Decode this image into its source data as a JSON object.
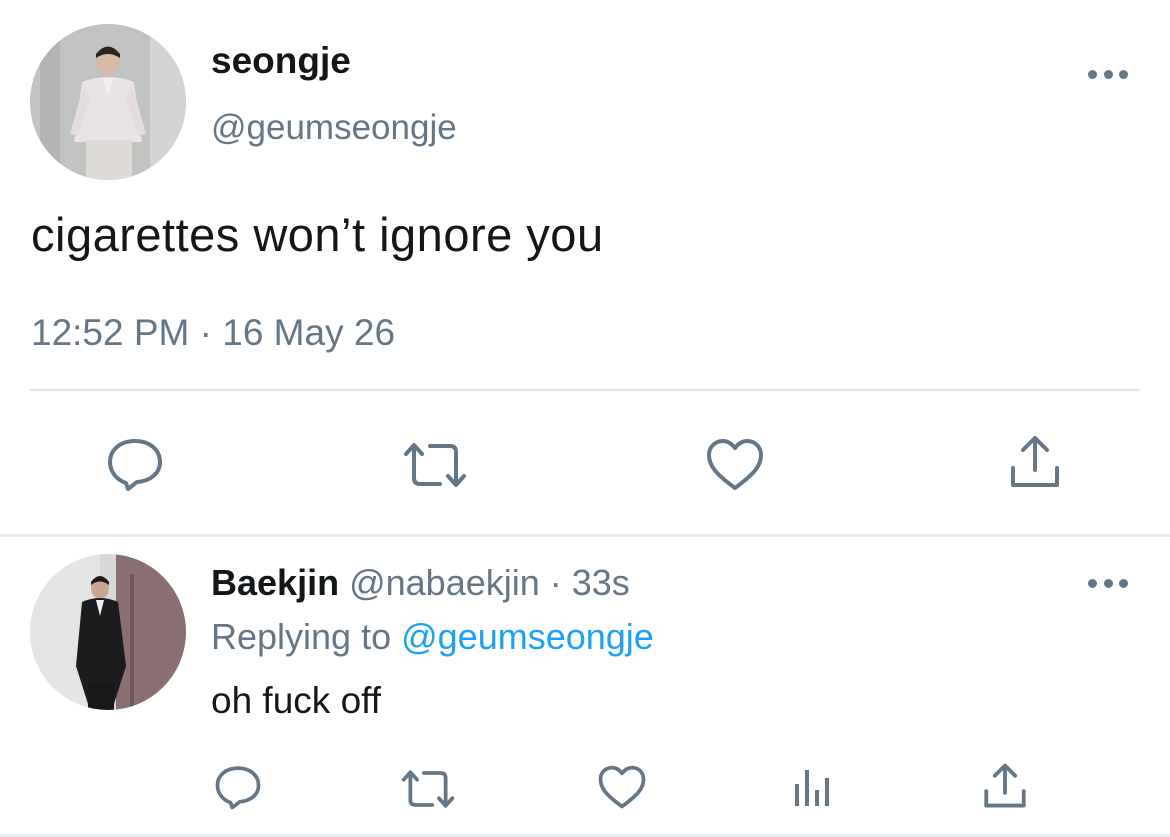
{
  "main_tweet": {
    "display_name": "seongje",
    "handle": "@geumseongje",
    "text": "cigarettes won’t ignore you",
    "timestamp": "12:52 PM · 16 May 26",
    "actions": {
      "reply_icon": "reply-icon",
      "retweet_icon": "retweet-icon",
      "like_icon": "heart-icon",
      "share_icon": "share-icon"
    }
  },
  "reply_tweet": {
    "display_name": "Baekjin",
    "handle": "@nabaekjin",
    "separator": " · ",
    "time_ago": "33s",
    "replying_prefix": "Replying to ",
    "replying_to": "@geumseongje",
    "text": "oh fuck off",
    "actions": {
      "reply_icon": "reply-icon",
      "retweet_icon": "retweet-icon",
      "like_icon": "heart-icon",
      "analytics_icon": "analytics-icon",
      "share_icon": "share-icon"
    }
  },
  "colors": {
    "text": "#14171a",
    "secondary": "#657786",
    "link": "#1da1f2",
    "divider": "#e1e8ed"
  }
}
